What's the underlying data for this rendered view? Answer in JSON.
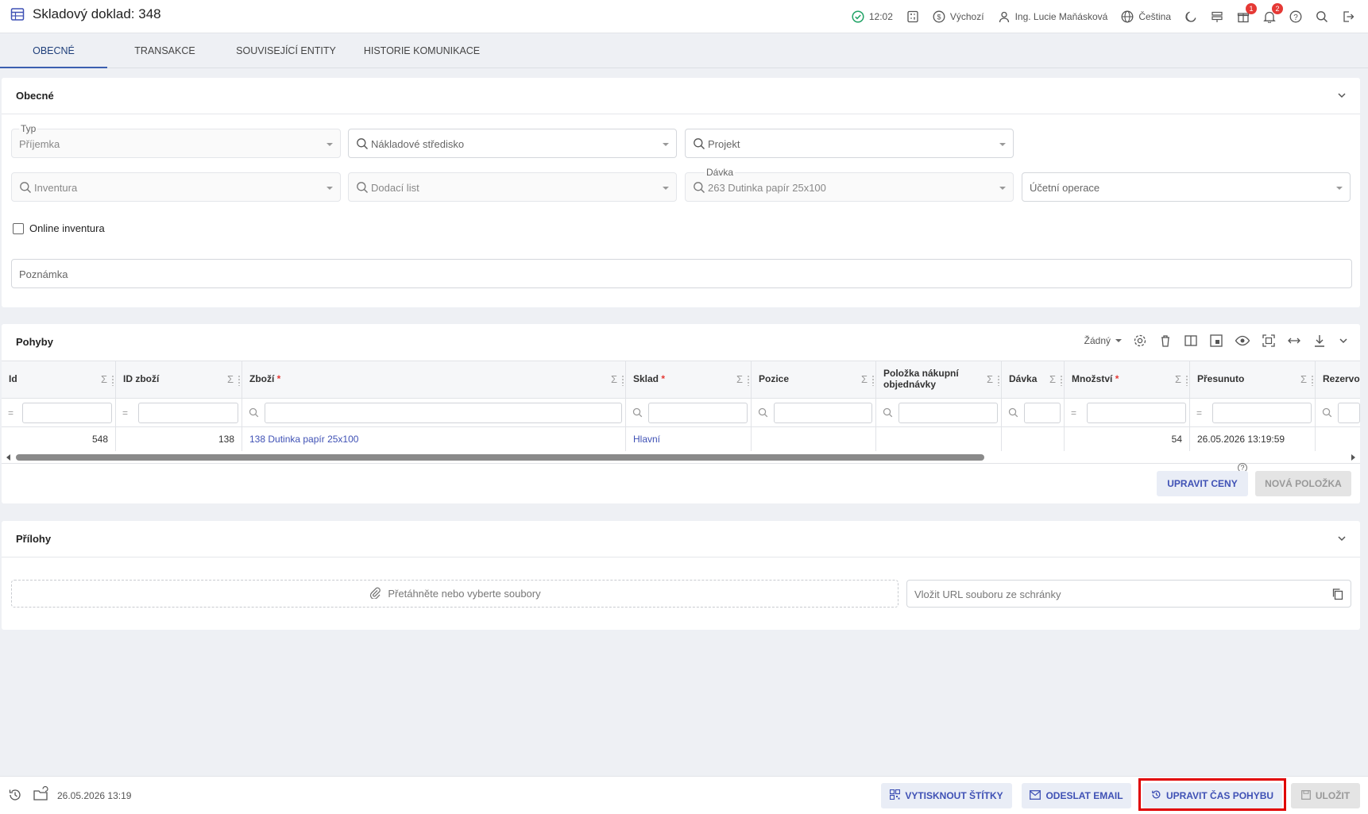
{
  "header": {
    "title": "Skladový doklad: 348",
    "time": "12:02",
    "currency": "Výchozí",
    "user": "Ing. Lucie Maňásková",
    "language": "Čeština",
    "gift_badge": "1",
    "notif_badge": "2"
  },
  "tabs": [
    "OBECNÉ",
    "TRANSAKCE",
    "SOUVISEJÍCÍ ENTITY",
    "HISTORIE KOMUNIKACE"
  ],
  "general": {
    "title": "Obecné",
    "type_label": "Typ",
    "type_value": "Příjemka",
    "cost_center": "Nákladové středisko",
    "project": "Projekt",
    "inventory": "Inventura",
    "delivery_note": "Dodací list",
    "batch_label": "Dávka",
    "batch_value": "263 Dutinka papír 25x100",
    "accounting_operation": "Účetní operace",
    "online_inventory": "Online inventura",
    "note": "Poznámka"
  },
  "movements": {
    "title": "Pohyby",
    "view_select": "Žádný",
    "columns": [
      {
        "label": "Id",
        "required": false
      },
      {
        "label": "ID zboží",
        "required": false
      },
      {
        "label": "Zboží",
        "required": true
      },
      {
        "label": "Sklad",
        "required": true
      },
      {
        "label": "Pozice",
        "required": false
      },
      {
        "label": "Položka nákupní objednávky",
        "required": false
      },
      {
        "label": "Dávka",
        "required": false
      },
      {
        "label": "Množství",
        "required": true
      },
      {
        "label": "Přesunuto",
        "required": false
      },
      {
        "label": "Rezervo",
        "required": false
      }
    ],
    "rows": [
      {
        "id": "548",
        "item_id": "138",
        "item": "138 Dutinka papír 25x100",
        "warehouse": "Hlavní",
        "position": "",
        "po_item": "",
        "batch": "",
        "quantity": "54",
        "moved": "26.05.2026 13:19:59"
      }
    ],
    "btn_edit_prices": "UPRAVIT CENY",
    "btn_new_item": "NOVÁ POLOŽKA",
    "help": "?"
  },
  "attachments": {
    "title": "Přílohy",
    "drop_text": "Přetáhněte nebo vyberte soubory",
    "url_placeholder": "Vložit URL souboru ze schránky"
  },
  "footer": {
    "timestamp": "26.05.2026 13:19",
    "btn_print_labels": "VYTISKNOUT ŠTÍTKY",
    "btn_send_email": "ODESLAT EMAIL",
    "btn_edit_time": "UPRAVIT ČAS POHYBU",
    "btn_save": "ULOŽIT"
  },
  "colors": {
    "accent": "#3f51b5",
    "highlight": "#e00000",
    "ok": "#21a366",
    "badge": "#e53935"
  }
}
